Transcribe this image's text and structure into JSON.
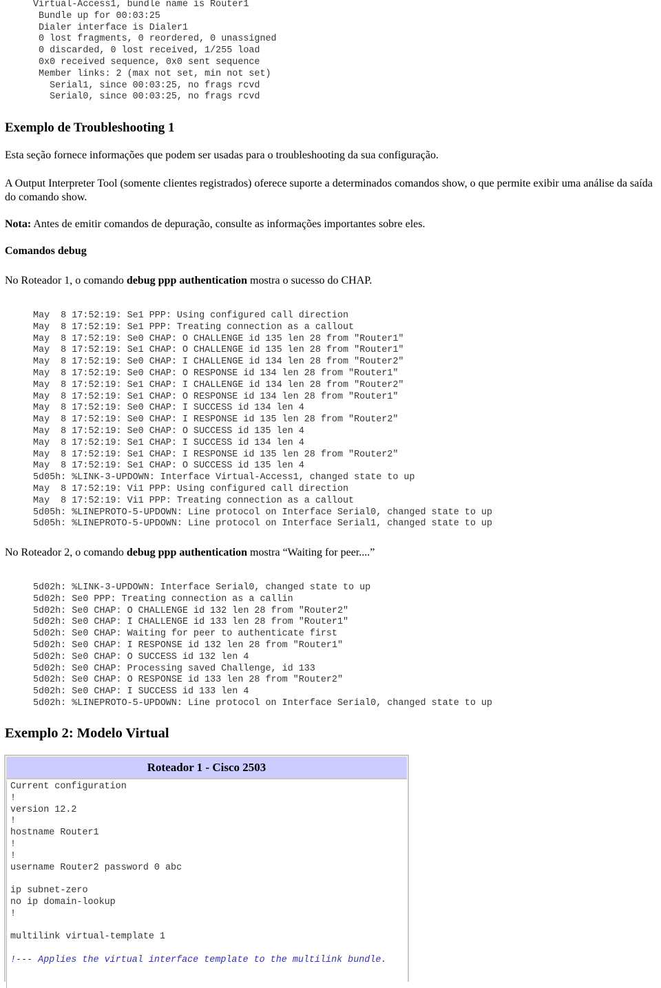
{
  "show_output": {
    "lines": [
      "Virtual-Access1, bundle name is Router1",
      " Bundle up for 00:03:25",
      " Dialer interface is Dialer1",
      " 0 lost fragments, 0 reordered, 0 unassigned",
      " 0 discarded, 0 lost received, 1/255 load",
      " 0x0 received sequence, 0x0 sent sequence",
      " Member links: 2 (max not set, min not set)",
      "   Serial1, since 00:03:25, no frags rcvd",
      "   Serial0, since 00:03:25, no frags rcvd"
    ]
  },
  "section1": {
    "heading": "Exemplo de Troubleshooting 1",
    "intro": "Esta seção fornece informações que podem ser usadas para o troubleshooting da sua configuração.",
    "oit_paragraph": "A Output Interpreter Tool (somente clientes registrados) oferece suporte a determinados comandos show, o que permite exibir uma análise da saída do comando show.",
    "note_label": "Nota:",
    "note_text": " Antes de emitir comandos de depuração, consulte as informações importantes sobre eles.",
    "debug_heading": "Comandos debug",
    "router1_pre": "No Roteador 1, o comando ",
    "router1_cmd": "debug ppp authentication",
    "router1_post": " mostra o sucesso do CHAP.",
    "router2_pre": "No Roteador 2, o comando ",
    "router2_cmd": "debug ppp authentication",
    "router2_post": " mostra “Waiting for peer....”"
  },
  "router1_debug": {
    "lines": [
      "May  8 17:52:19: Se1 PPP: Using configured call direction",
      "May  8 17:52:19: Se1 PPP: Treating connection as a callout",
      "May  8 17:52:19: Se0 CHAP: O CHALLENGE id 135 len 28 from \"Router1\"",
      "May  8 17:52:19: Se1 CHAP: O CHALLENGE id 135 len 28 from \"Router1\"",
      "May  8 17:52:19: Se0 CHAP: I CHALLENGE id 134 len 28 from \"Router2\"",
      "May  8 17:52:19: Se0 CHAP: O RESPONSE id 134 len 28 from \"Router1\"",
      "May  8 17:52:19: Se1 CHAP: I CHALLENGE id 134 len 28 from \"Router2\"",
      "May  8 17:52:19: Se1 CHAP: O RESPONSE id 134 len 28 from \"Router1\"",
      "May  8 17:52:19: Se0 CHAP: I SUCCESS id 134 len 4",
      "May  8 17:52:19: Se0 CHAP: I RESPONSE id 135 len 28 from \"Router2\"",
      "May  8 17:52:19: Se0 CHAP: O SUCCESS id 135 len 4",
      "May  8 17:52:19: Se1 CHAP: I SUCCESS id 134 len 4",
      "May  8 17:52:19: Se1 CHAP: I RESPONSE id 135 len 28 from \"Router2\"",
      "May  8 17:52:19: Se1 CHAP: O SUCCESS id 135 len 4",
      "5d05h: %LINK-3-UPDOWN: Interface Virtual-Access1, changed state to up",
      "May  8 17:52:19: Vi1 PPP: Using configured call direction",
      "May  8 17:52:19: Vi1 PPP: Treating connection as a callout",
      "5d05h: %LINEPROTO-5-UPDOWN: Line protocol on Interface Serial0, changed state to up",
      "5d05h: %LINEPROTO-5-UPDOWN: Line protocol on Interface Serial1, changed state to up"
    ]
  },
  "router2_debug": {
    "lines": [
      "5d02h: %LINK-3-UPDOWN: Interface Serial0, changed state to up",
      "5d02h: Se0 PPP: Treating connection as a callin",
      "5d02h: Se0 CHAP: O CHALLENGE id 132 len 28 from \"Router2\"",
      "5d02h: Se0 CHAP: I CHALLENGE id 133 len 28 from \"Router1\"",
      "5d02h: Se0 CHAP: Waiting for peer to authenticate first",
      "5d02h: Se0 CHAP: I RESPONSE id 132 len 28 from \"Router1\"",
      "5d02h: Se0 CHAP: O SUCCESS id 132 len 4",
      "5d02h: Se0 CHAP: Processing saved Challenge, id 133",
      "5d02h: Se0 CHAP: O RESPONSE id 133 len 28 from \"Router2\"",
      "5d02h: Se0 CHAP: I SUCCESS id 133 len 4",
      "5d02h: %LINEPROTO-5-UPDOWN: Line protocol on Interface Serial0, changed state to up"
    ]
  },
  "section2": {
    "heading": "Exemplo 2: Modelo Virtual",
    "table_title": "Roteador 1 - Cisco 2503",
    "header_color": "#ccccff",
    "comment_color": "#3333aa",
    "config_lines": [
      "Current configuration",
      "!",
      "version 12.2",
      "!",
      "hostname Router1",
      "!",
      "!",
      "username Router2 password 0 abc",
      "",
      "ip subnet-zero",
      "no ip domain-lookup",
      "!",
      "",
      "multilink virtual-template 1",
      ""
    ],
    "comment_line": "!--- Applies the virtual interface template to the multilink bundle."
  }
}
